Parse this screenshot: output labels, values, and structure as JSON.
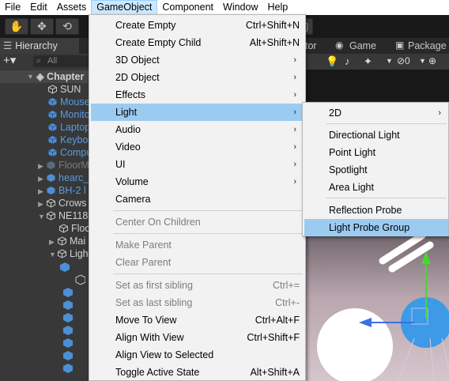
{
  "menubar": {
    "items": [
      "File",
      "Edit",
      "Assets",
      "GameObject",
      "Component",
      "Window",
      "Help"
    ],
    "active": "GameObject"
  },
  "hierarchy": {
    "tab_label": "Hierarchy",
    "search_placeholder": "All",
    "rows": [
      {
        "label": "Chapter",
        "style": "scene"
      },
      {
        "label": "SUN",
        "style": "normal"
      },
      {
        "label": "Mouse",
        "style": "blue"
      },
      {
        "label": "Monito",
        "style": "blue"
      },
      {
        "label": "Laptop",
        "style": "blue"
      },
      {
        "label": "Keybo",
        "style": "blue"
      },
      {
        "label": "Compu",
        "style": "blue"
      },
      {
        "label": "FloorM",
        "style": "grey"
      },
      {
        "label": "hearc_",
        "style": "blue"
      },
      {
        "label": "BH-2 l",
        "style": "blue"
      },
      {
        "label": "Crows",
        "style": "normal"
      },
      {
        "label": "NE118",
        "style": "normal"
      },
      {
        "label": "Floo",
        "style": "normal"
      },
      {
        "label": "Mai",
        "style": "normal"
      },
      {
        "label": "Ligh",
        "style": "normal"
      }
    ]
  },
  "scene": {
    "tabs": [
      "tor",
      "Game",
      "Package"
    ]
  },
  "gameobject_menu": {
    "items": [
      {
        "label": "Create Empty",
        "shortcut": "Ctrl+Shift+N"
      },
      {
        "label": "Create Empty Child",
        "shortcut": "Alt+Shift+N"
      },
      {
        "label": "3D Object",
        "submenu": true
      },
      {
        "label": "2D Object",
        "submenu": true
      },
      {
        "label": "Effects",
        "submenu": true
      },
      {
        "label": "Light",
        "submenu": true,
        "highlighted": true
      },
      {
        "label": "Audio",
        "submenu": true
      },
      {
        "label": "Video",
        "submenu": true
      },
      {
        "label": "UI",
        "submenu": true
      },
      {
        "label": "Volume",
        "submenu": true
      },
      {
        "label": "Camera"
      },
      {
        "label": "Center On Children",
        "disabled": true
      },
      {
        "label": "Make Parent",
        "disabled": true
      },
      {
        "label": "Clear Parent",
        "disabled": true
      },
      {
        "label": "Set as first sibling",
        "shortcut": "Ctrl+=",
        "disabled": true
      },
      {
        "label": "Set as last sibling",
        "shortcut": "Ctrl+-",
        "disabled": true
      },
      {
        "label": "Move To View",
        "shortcut": "Ctrl+Alt+F"
      },
      {
        "label": "Align With View",
        "shortcut": "Ctrl+Shift+F"
      },
      {
        "label": "Align View to Selected"
      },
      {
        "label": "Toggle Active State",
        "shortcut": "Alt+Shift+A"
      }
    ]
  },
  "light_submenu": {
    "items": [
      {
        "label": "2D",
        "submenu": true
      },
      {
        "label": "Directional Light"
      },
      {
        "label": "Point Light"
      },
      {
        "label": "Spotlight"
      },
      {
        "label": "Area Light"
      },
      {
        "label": "Reflection Probe"
      },
      {
        "label": "Light Probe Group",
        "highlighted": true
      }
    ]
  },
  "colors": {
    "highlight": "#9ccbf2",
    "menubar_active": "#cce8ff",
    "prefab_blue": "#5b9bde"
  }
}
